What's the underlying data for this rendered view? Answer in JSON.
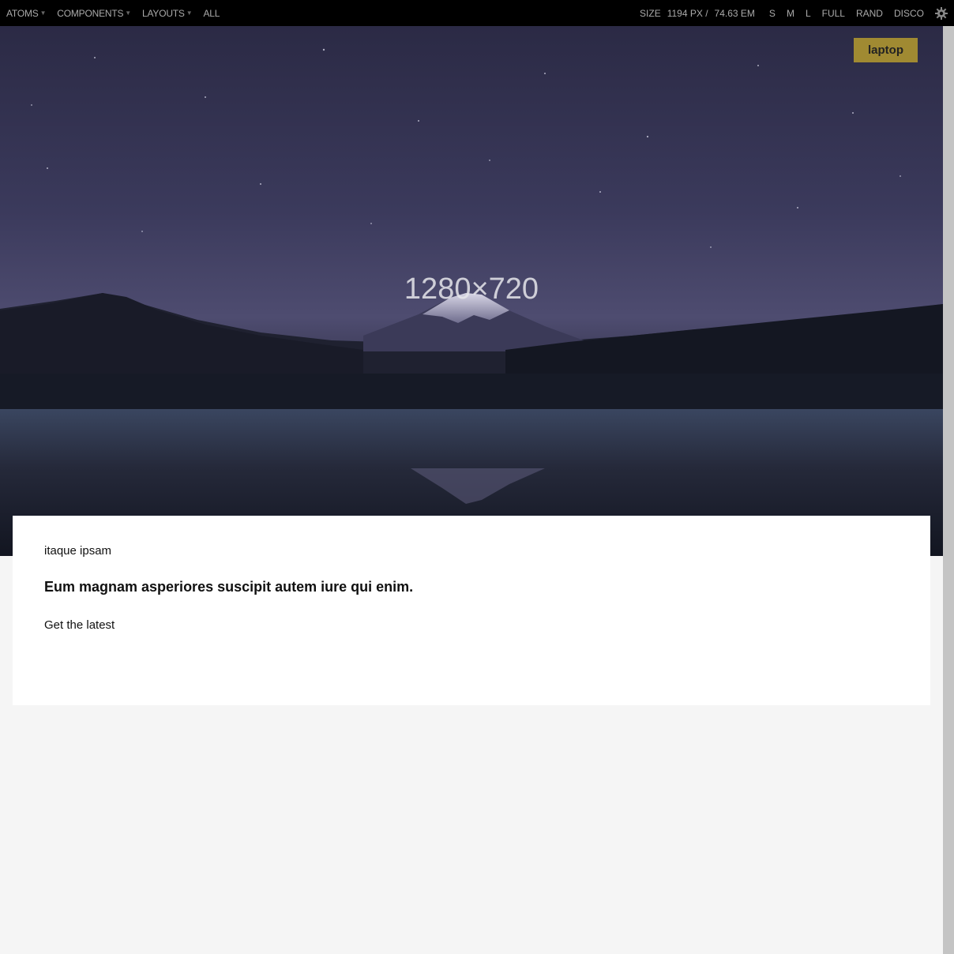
{
  "toolbar": {
    "nav": [
      {
        "label": "ATOMS",
        "dropdown": true
      },
      {
        "label": "COMPONENTS",
        "dropdown": true
      },
      {
        "label": "LAYOUTS",
        "dropdown": true
      },
      {
        "label": "ALL",
        "dropdown": false
      }
    ],
    "size_label": "SIZE",
    "size_px": "1194",
    "size_px_unit": "PX /",
    "size_em": "74.63",
    "size_em_unit": "EM",
    "presets": [
      "S",
      "M",
      "L",
      "FULL",
      "RAND",
      "DISCO"
    ],
    "settings_icon": "gear-icon"
  },
  "viewport": {
    "badge": "laptop"
  },
  "hero": {
    "placeholder_text": "1280×720"
  },
  "card": {
    "eyebrow": "itaque ipsam",
    "headline": "Eum magnam asperiores suscipit autem iure qui enim.",
    "cta": "Get the latest"
  }
}
